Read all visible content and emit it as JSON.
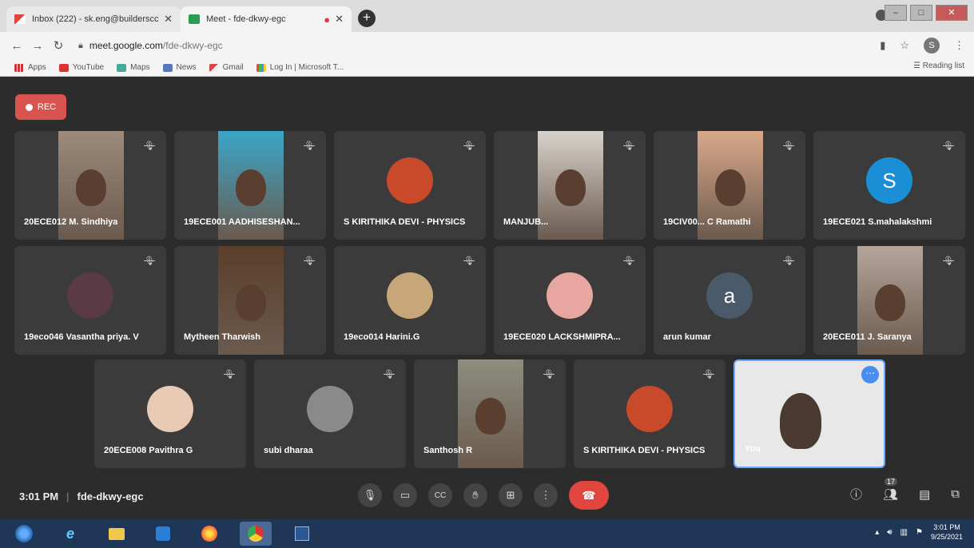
{
  "browser": {
    "tabs": [
      {
        "title": "Inbox (222) - sk.eng@builderscc",
        "favicon": "gmail-icon",
        "active": false
      },
      {
        "title": "Meet - fde-dkwy-egc",
        "favicon": "meet-icon",
        "active": true
      }
    ],
    "url_host": "meet.google.com",
    "url_path": "/fde-dkwy-egc",
    "profile_initial": "S",
    "bookmarks": [
      "Apps",
      "YouTube",
      "Maps",
      "News",
      "Gmail",
      "Log In | Microsoft T..."
    ],
    "reading_list": "Reading list"
  },
  "meet": {
    "rec_label": "REC",
    "time": "3:01 PM",
    "meeting_code": "fde-dkwy-egc",
    "participants_count": "17",
    "tiles": [
      {
        "name": "20ECE012 M. Sindhiya",
        "kind": "video",
        "bg": "#9c8a7a"
      },
      {
        "name": "19ECE001 AADHISESHAN...",
        "kind": "video",
        "bg": "#3aa6c8"
      },
      {
        "name": "S KIRITHIKA DEVI - PHYSICS",
        "kind": "avatar",
        "bg": "#c84a2a",
        "initial": ""
      },
      {
        "name": "MANJUB...",
        "kind": "video",
        "bg": "#d8d2cc"
      },
      {
        "name": "19CIV00... C Ramathi",
        "kind": "video",
        "bg": "#d9a88a"
      },
      {
        "name": "19ECE021 S.mahalakshmi",
        "kind": "avatar",
        "bg": "#1a8fd6",
        "initial": "S"
      },
      {
        "name": "19eco046 Vasantha priya. V",
        "kind": "avatar",
        "bg": "#5a3a44",
        "initial": ""
      },
      {
        "name": "Mytheen Tharwish",
        "kind": "video",
        "bg": "#5b3e2a"
      },
      {
        "name": "19eco014 Harini.G",
        "kind": "avatar",
        "bg": "#c7a77a",
        "initial": ""
      },
      {
        "name": "19ECE020 LACKSHMIPRA...",
        "kind": "avatar",
        "bg": "#e8a6a0",
        "initial": ""
      },
      {
        "name": "arun kumar",
        "kind": "avatar",
        "bg": "#4b5a6a",
        "initial": "a"
      },
      {
        "name": "20ECE011 J. Saranya",
        "kind": "video",
        "bg": "#b5a59a"
      },
      {
        "name": "20ECE008 Pavithra G",
        "kind": "avatar",
        "bg": "#e8c9b4",
        "initial": ""
      },
      {
        "name": "subi dharaa",
        "kind": "avatar",
        "bg": "#8a8a8a",
        "initial": ""
      },
      {
        "name": "Santhosh R",
        "kind": "video",
        "bg": "#8d8e7e"
      },
      {
        "name": "S KIRITHIKA DEVI - PHYSICS",
        "kind": "avatar",
        "bg": "#c84a2a",
        "initial": ""
      },
      {
        "name": "You",
        "kind": "self",
        "bg": "#e6e6e6"
      }
    ]
  },
  "taskbar": {
    "clock_time": "3:01 PM",
    "clock_date": "9/25/2021"
  }
}
